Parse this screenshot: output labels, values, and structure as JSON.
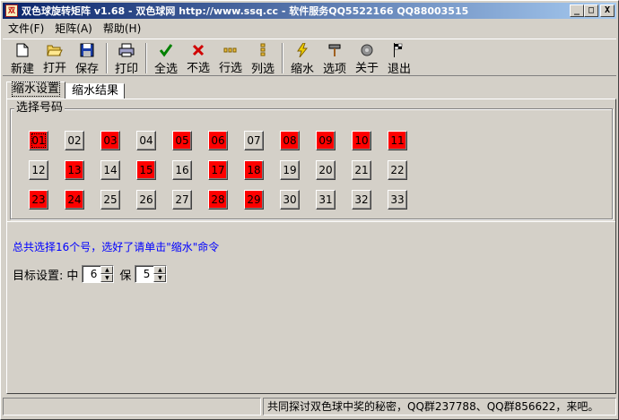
{
  "window": {
    "title": "双色球旋转矩阵 v1.68 - 双色球网 http://www.ssq.cc - 软件服务QQ5522166 QQ88003515",
    "app_icon": "双",
    "controls": {
      "minimize": "_",
      "maximize": "□",
      "close": "X"
    }
  },
  "menu": [
    {
      "label": "文件(F)"
    },
    {
      "label": "矩阵(A)"
    },
    {
      "label": "帮助(H)"
    }
  ],
  "toolbar": [
    {
      "id": "new",
      "label": "新建",
      "icon": "new-file-icon"
    },
    {
      "id": "open",
      "label": "打开",
      "icon": "open-folder-icon"
    },
    {
      "id": "save",
      "label": "保存",
      "icon": "save-disk-icon"
    },
    {
      "id": "print",
      "label": "打印",
      "icon": "printer-icon"
    },
    {
      "id": "select-all",
      "label": "全选",
      "icon": "checkmark-icon"
    },
    {
      "id": "select-none",
      "label": "不选",
      "icon": "red-x-icon"
    },
    {
      "id": "select-row",
      "label": "行选",
      "icon": "row-select-icon"
    },
    {
      "id": "select-col",
      "label": "列选",
      "icon": "column-select-icon"
    },
    {
      "id": "shrink",
      "label": "缩水",
      "icon": "lightning-icon"
    },
    {
      "id": "options",
      "label": "选项",
      "icon": "hammer-icon"
    },
    {
      "id": "about",
      "label": "关于",
      "icon": "about-globe-icon"
    },
    {
      "id": "exit",
      "label": "退出",
      "icon": "checkered-flag-icon"
    }
  ],
  "tabs": [
    {
      "label": "缩水设置",
      "active": true
    },
    {
      "label": "缩水结果",
      "active": false
    }
  ],
  "number_group": {
    "legend": "选择号码",
    "numbers": [
      {
        "n": "01",
        "sel": true
      },
      {
        "n": "02",
        "sel": false
      },
      {
        "n": "03",
        "sel": true
      },
      {
        "n": "04",
        "sel": false
      },
      {
        "n": "05",
        "sel": true
      },
      {
        "n": "06",
        "sel": true
      },
      {
        "n": "07",
        "sel": false
      },
      {
        "n": "08",
        "sel": true
      },
      {
        "n": "09",
        "sel": true
      },
      {
        "n": "10",
        "sel": true
      },
      {
        "n": "11",
        "sel": true
      },
      {
        "n": "12",
        "sel": false
      },
      {
        "n": "13",
        "sel": true
      },
      {
        "n": "14",
        "sel": false
      },
      {
        "n": "15",
        "sel": true
      },
      {
        "n": "16",
        "sel": false
      },
      {
        "n": "17",
        "sel": true
      },
      {
        "n": "18",
        "sel": true
      },
      {
        "n": "19",
        "sel": false
      },
      {
        "n": "20",
        "sel": false
      },
      {
        "n": "21",
        "sel": false
      },
      {
        "n": "22",
        "sel": false
      },
      {
        "n": "23",
        "sel": true
      },
      {
        "n": "24",
        "sel": true
      },
      {
        "n": "25",
        "sel": false
      },
      {
        "n": "26",
        "sel": false
      },
      {
        "n": "27",
        "sel": false
      },
      {
        "n": "28",
        "sel": true
      },
      {
        "n": "29",
        "sel": true
      },
      {
        "n": "30",
        "sel": false
      },
      {
        "n": "31",
        "sel": false
      },
      {
        "n": "32",
        "sel": false
      },
      {
        "n": "33",
        "sel": false
      }
    ],
    "selected_color": "#ff0000"
  },
  "info_text": "总共选择16个号，选好了请单击\"缩水\"命令",
  "target": {
    "label": "目标设置:",
    "zhong_label": "中",
    "zhong_value": "6",
    "bao_label": "保",
    "bao_value": "5"
  },
  "status": {
    "left": "",
    "right": "共同探讨双色球中奖的秘密，QQ群237788、QQ群856622，来吧。"
  }
}
